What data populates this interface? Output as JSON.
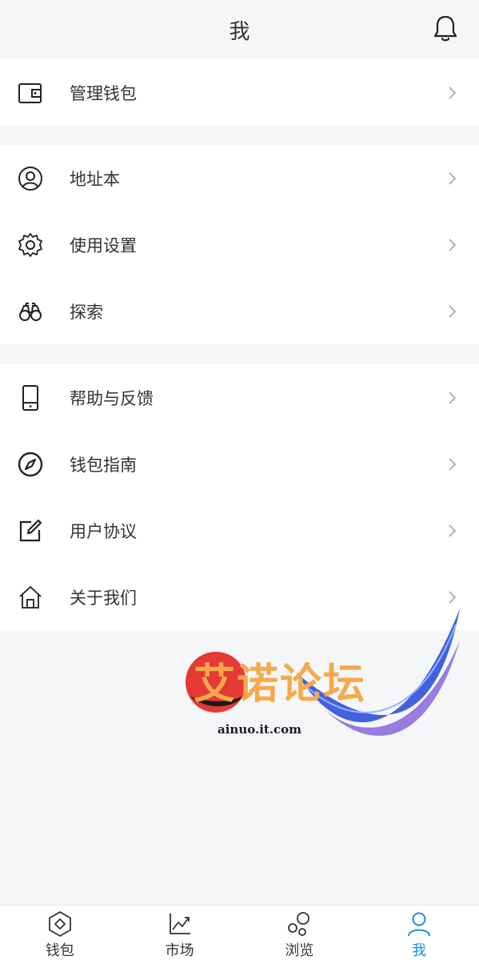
{
  "header": {
    "title": "我",
    "bell_icon": "bell-icon"
  },
  "groups": [
    {
      "items": [
        {
          "label": "管理钱包",
          "icon": "wallet-icon"
        }
      ]
    },
    {
      "items": [
        {
          "label": "地址本",
          "icon": "user-circle-icon"
        },
        {
          "label": "使用设置",
          "icon": "gear-icon"
        },
        {
          "label": "探索",
          "icon": "binoculars-icon"
        }
      ]
    },
    {
      "items": [
        {
          "label": "帮助与反馈",
          "icon": "phone-icon"
        },
        {
          "label": "钱包指南",
          "icon": "compass-icon"
        },
        {
          "label": "用户协议",
          "icon": "edit-icon"
        },
        {
          "label": "关于我们",
          "icon": "home-icon"
        }
      ]
    }
  ],
  "watermark": {
    "text": "艾诺论坛",
    "url": "ainuo.it.com"
  },
  "tabbar": {
    "tabs": [
      {
        "label": "钱包",
        "icon": "wallet-diamond-icon",
        "active": false
      },
      {
        "label": "市场",
        "icon": "chart-icon",
        "active": false
      },
      {
        "label": "浏览",
        "icon": "bubbles-icon",
        "active": false
      },
      {
        "label": "我",
        "icon": "person-icon",
        "active": true
      }
    ],
    "active_color": "#1a8fe3"
  }
}
